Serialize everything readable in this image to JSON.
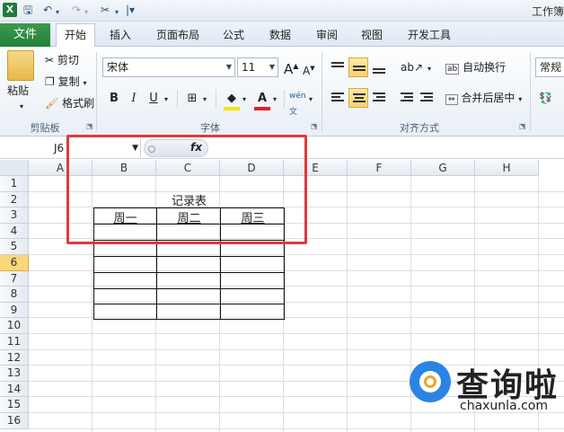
{
  "window": {
    "title": "工作簿"
  },
  "qat": {
    "icons": [
      "excel-icon",
      "save-icon",
      "undo-icon",
      "redo-icon",
      "customize-icon"
    ]
  },
  "tabs": {
    "file": "文件",
    "items": [
      "开始",
      "插入",
      "页面布局",
      "公式",
      "数据",
      "审阅",
      "视图",
      "开发工具"
    ],
    "active": "开始"
  },
  "ribbon": {
    "clipboard": {
      "paste": "粘贴",
      "cut": "剪切",
      "copy": "复制",
      "format_painter": "格式刷",
      "label": "剪贴板"
    },
    "font": {
      "name": "宋体",
      "size": "11",
      "bold": "B",
      "italic": "I",
      "underline": "U",
      "label": "字体",
      "phonetic": "wén",
      "font_color": "A"
    },
    "alignment": {
      "wrap_text": "自动换行",
      "merge_center": "合并后居中",
      "label": "对齐方式"
    },
    "number": {
      "format": "常规"
    }
  },
  "formula_bar": {
    "name_box": "J6",
    "fx": "fx",
    "content": ""
  },
  "grid": {
    "columns": [
      "A",
      "B",
      "C",
      "D",
      "E",
      "F",
      "G",
      "H"
    ],
    "rows": [
      "1",
      "2",
      "3",
      "4",
      "5",
      "6",
      "7",
      "8",
      "9",
      "10",
      "11",
      "12",
      "13",
      "14",
      "15",
      "16"
    ],
    "selected_row": "6"
  },
  "sheet": {
    "title": "记录表",
    "headers": [
      "周一",
      "周二",
      "周三"
    ]
  },
  "watermark": {
    "brand": "查询啦",
    "domain": "chaxunla.com"
  },
  "colors": {
    "file_tab": "#21803a",
    "highlight": "#e0393e",
    "logo_blue": "#2b84e4",
    "logo_orange": "#f3a423"
  }
}
